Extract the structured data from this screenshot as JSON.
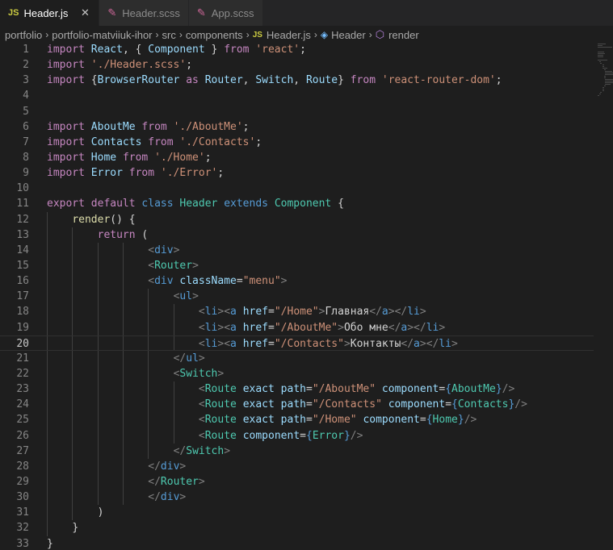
{
  "tabs": [
    {
      "label": "Header.js",
      "type": "js",
      "active": true,
      "close": "✕"
    },
    {
      "label": "Header.scss",
      "type": "scss",
      "active": false
    },
    {
      "label": "App.scss",
      "type": "scss",
      "active": false
    }
  ],
  "breadcrumb": [
    "portfolio",
    "portfolio-matviiuk-ihor",
    "src",
    "components",
    "Header.js",
    "Header",
    "render"
  ],
  "editor": {
    "current_line": 20,
    "lines": [
      {
        "n": "1",
        "indent": 0,
        "tokens": [
          [
            "kw",
            "import"
          ],
          [
            "pun",
            " "
          ],
          [
            "var",
            "React"
          ],
          [
            "pun",
            ", { "
          ],
          [
            "var",
            "Component"
          ],
          [
            "pun",
            " } "
          ],
          [
            "kw",
            "from"
          ],
          [
            "pun",
            " "
          ],
          [
            "str",
            "'react'"
          ],
          [
            "pun",
            ";"
          ]
        ]
      },
      {
        "n": "2",
        "indent": 0,
        "tokens": [
          [
            "kw",
            "import"
          ],
          [
            "pun",
            " "
          ],
          [
            "str",
            "'./Header.scss'"
          ],
          [
            "pun",
            ";"
          ]
        ]
      },
      {
        "n": "3",
        "indent": 0,
        "tokens": [
          [
            "kw",
            "import"
          ],
          [
            "pun",
            " {"
          ],
          [
            "var",
            "BrowserRouter"
          ],
          [
            "pun",
            " "
          ],
          [
            "kw",
            "as"
          ],
          [
            "pun",
            " "
          ],
          [
            "var",
            "Router"
          ],
          [
            "pun",
            ", "
          ],
          [
            "var",
            "Switch"
          ],
          [
            "pun",
            ", "
          ],
          [
            "var",
            "Route"
          ],
          [
            "pun",
            "} "
          ],
          [
            "kw",
            "from"
          ],
          [
            "pun",
            " "
          ],
          [
            "str",
            "'react-router-dom'"
          ],
          [
            "pun",
            ";"
          ]
        ]
      },
      {
        "n": "4",
        "indent": 0,
        "tokens": []
      },
      {
        "n": "5",
        "indent": 0,
        "tokens": []
      },
      {
        "n": "6",
        "indent": 0,
        "tokens": [
          [
            "kw",
            "import"
          ],
          [
            "pun",
            " "
          ],
          [
            "var",
            "AboutMe"
          ],
          [
            "pun",
            " "
          ],
          [
            "kw",
            "from"
          ],
          [
            "pun",
            " "
          ],
          [
            "str",
            "'./AboutMe'"
          ],
          [
            "pun",
            ";"
          ]
        ]
      },
      {
        "n": "7",
        "indent": 0,
        "tokens": [
          [
            "kw",
            "import"
          ],
          [
            "pun",
            " "
          ],
          [
            "var",
            "Contacts"
          ],
          [
            "pun",
            " "
          ],
          [
            "kw",
            "from"
          ],
          [
            "pun",
            " "
          ],
          [
            "str",
            "'./Contacts'"
          ],
          [
            "pun",
            ";"
          ]
        ]
      },
      {
        "n": "8",
        "indent": 0,
        "tokens": [
          [
            "kw",
            "import"
          ],
          [
            "pun",
            " "
          ],
          [
            "var",
            "Home"
          ],
          [
            "pun",
            " "
          ],
          [
            "kw",
            "from"
          ],
          [
            "pun",
            " "
          ],
          [
            "str",
            "'./Home'"
          ],
          [
            "pun",
            ";"
          ]
        ]
      },
      {
        "n": "9",
        "indent": 0,
        "tokens": [
          [
            "kw",
            "import"
          ],
          [
            "pun",
            " "
          ],
          [
            "var",
            "Error"
          ],
          [
            "pun",
            " "
          ],
          [
            "kw",
            "from"
          ],
          [
            "pun",
            " "
          ],
          [
            "str",
            "'./Error'"
          ],
          [
            "pun",
            ";"
          ]
        ]
      },
      {
        "n": "10",
        "indent": 0,
        "tokens": []
      },
      {
        "n": "11",
        "indent": 0,
        "tokens": [
          [
            "kw",
            "export"
          ],
          [
            "pun",
            " "
          ],
          [
            "kw",
            "default"
          ],
          [
            "pun",
            " "
          ],
          [
            "kw2",
            "class"
          ],
          [
            "pun",
            " "
          ],
          [
            "cls",
            "Header"
          ],
          [
            "pun",
            " "
          ],
          [
            "kw2",
            "extends"
          ],
          [
            "pun",
            " "
          ],
          [
            "cls",
            "Component"
          ],
          [
            "pun",
            " {"
          ]
        ]
      },
      {
        "n": "12",
        "indent": 1,
        "tokens": [
          [
            "fn",
            "render"
          ],
          [
            "pun",
            "() {"
          ]
        ]
      },
      {
        "n": "13",
        "indent": 2,
        "tokens": [
          [
            "kw",
            "return"
          ],
          [
            "pun",
            " ("
          ]
        ]
      },
      {
        "n": "14",
        "indent": 4,
        "tokens": [
          [
            "tag",
            "<"
          ],
          [
            "kw2",
            "div"
          ],
          [
            "tag",
            ">"
          ]
        ]
      },
      {
        "n": "15",
        "indent": 4,
        "tokens": [
          [
            "tag",
            "<"
          ],
          [
            "cls",
            "Router"
          ],
          [
            "tag",
            ">"
          ]
        ]
      },
      {
        "n": "16",
        "indent": 4,
        "tokens": [
          [
            "tag",
            "<"
          ],
          [
            "kw2",
            "div"
          ],
          [
            "pun",
            " "
          ],
          [
            "var",
            "className"
          ],
          [
            "pun",
            "="
          ],
          [
            "str",
            "\"menu\""
          ],
          [
            "tag",
            ">"
          ]
        ]
      },
      {
        "n": "17",
        "indent": 5,
        "tokens": [
          [
            "tag",
            "<"
          ],
          [
            "kw2",
            "ul"
          ],
          [
            "tag",
            ">"
          ]
        ]
      },
      {
        "n": "18",
        "indent": 6,
        "tokens": [
          [
            "tag",
            "<"
          ],
          [
            "kw2",
            "li"
          ],
          [
            "tag",
            "><"
          ],
          [
            "kw2",
            "a"
          ],
          [
            "pun",
            " "
          ],
          [
            "var",
            "href"
          ],
          [
            "pun",
            "="
          ],
          [
            "str",
            "\"/Home\""
          ],
          [
            "tag",
            ">"
          ],
          [
            "txt",
            "Главная"
          ],
          [
            "tag",
            "</"
          ],
          [
            "kw2",
            "a"
          ],
          [
            "tag",
            "></"
          ],
          [
            "kw2",
            "li"
          ],
          [
            "tag",
            ">"
          ]
        ]
      },
      {
        "n": "19",
        "indent": 6,
        "tokens": [
          [
            "tag",
            "<"
          ],
          [
            "kw2",
            "li"
          ],
          [
            "tag",
            "><"
          ],
          [
            "kw2",
            "a"
          ],
          [
            "pun",
            " "
          ],
          [
            "var",
            "href"
          ],
          [
            "pun",
            "="
          ],
          [
            "str",
            "\"/AboutMe\""
          ],
          [
            "tag",
            ">"
          ],
          [
            "txt",
            "Обо мне"
          ],
          [
            "tag",
            "</"
          ],
          [
            "kw2",
            "a"
          ],
          [
            "tag",
            "></"
          ],
          [
            "kw2",
            "li"
          ],
          [
            "tag",
            ">"
          ]
        ]
      },
      {
        "n": "20",
        "indent": 6,
        "tokens": [
          [
            "tag",
            "<"
          ],
          [
            "kw2",
            "li"
          ],
          [
            "tag",
            "><"
          ],
          [
            "kw2",
            "a"
          ],
          [
            "pun",
            " "
          ],
          [
            "var",
            "href"
          ],
          [
            "pun",
            "="
          ],
          [
            "str",
            "\"/Contacts\""
          ],
          [
            "tag",
            ">"
          ],
          [
            "txt",
            "Контакты"
          ],
          [
            "tag",
            "</"
          ],
          [
            "kw2",
            "a"
          ],
          [
            "tag",
            "><"
          ],
          [
            "tag",
            "/"
          ],
          [
            "kw2",
            "li"
          ],
          [
            "tag",
            ">"
          ]
        ]
      },
      {
        "n": "21",
        "indent": 5,
        "tokens": [
          [
            "tag",
            "</"
          ],
          [
            "kw2",
            "ul"
          ],
          [
            "tag",
            ">"
          ]
        ]
      },
      {
        "n": "22",
        "indent": 5,
        "tokens": [
          [
            "tag",
            "<"
          ],
          [
            "cls",
            "Switch"
          ],
          [
            "tag",
            ">"
          ]
        ]
      },
      {
        "n": "23",
        "indent": 6,
        "tokens": [
          [
            "tag",
            "<"
          ],
          [
            "cls",
            "Route"
          ],
          [
            "pun",
            " "
          ],
          [
            "var",
            "exact"
          ],
          [
            "pun",
            " "
          ],
          [
            "var",
            "path"
          ],
          [
            "pun",
            "="
          ],
          [
            "str",
            "\"/AboutMe\""
          ],
          [
            "pun",
            " "
          ],
          [
            "var",
            "component"
          ],
          [
            "pun",
            "="
          ],
          [
            "kw2",
            "{"
          ],
          [
            "cls",
            "AboutMe"
          ],
          [
            "kw2",
            "}"
          ],
          [
            "tag",
            "/>"
          ]
        ]
      },
      {
        "n": "24",
        "indent": 6,
        "tokens": [
          [
            "tag",
            "<"
          ],
          [
            "cls",
            "Route"
          ],
          [
            "pun",
            " "
          ],
          [
            "var",
            "exact"
          ],
          [
            "pun",
            " "
          ],
          [
            "var",
            "path"
          ],
          [
            "pun",
            "="
          ],
          [
            "str",
            "\"/Contacts\""
          ],
          [
            "pun",
            " "
          ],
          [
            "var",
            "component"
          ],
          [
            "pun",
            "="
          ],
          [
            "kw2",
            "{"
          ],
          [
            "cls",
            "Contacts"
          ],
          [
            "kw2",
            "}"
          ],
          [
            "tag",
            "/>"
          ]
        ]
      },
      {
        "n": "25",
        "indent": 6,
        "tokens": [
          [
            "tag",
            "<"
          ],
          [
            "cls",
            "Route"
          ],
          [
            "pun",
            " "
          ],
          [
            "var",
            "exact"
          ],
          [
            "pun",
            " "
          ],
          [
            "var",
            "path"
          ],
          [
            "pun",
            "="
          ],
          [
            "str",
            "\"/Home\""
          ],
          [
            "pun",
            " "
          ],
          [
            "var",
            "component"
          ],
          [
            "pun",
            "="
          ],
          [
            "kw2",
            "{"
          ],
          [
            "cls",
            "Home"
          ],
          [
            "kw2",
            "}"
          ],
          [
            "tag",
            "/>"
          ]
        ]
      },
      {
        "n": "26",
        "indent": 6,
        "tokens": [
          [
            "tag",
            "<"
          ],
          [
            "cls",
            "Route"
          ],
          [
            "pun",
            " "
          ],
          [
            "var",
            "component"
          ],
          [
            "pun",
            "="
          ],
          [
            "kw2",
            "{"
          ],
          [
            "cls",
            "Error"
          ],
          [
            "kw2",
            "}"
          ],
          [
            "tag",
            "/>"
          ]
        ]
      },
      {
        "n": "27",
        "indent": 5,
        "tokens": [
          [
            "tag",
            "</"
          ],
          [
            "cls",
            "Switch"
          ],
          [
            "tag",
            ">"
          ]
        ]
      },
      {
        "n": "28",
        "indent": 4,
        "tokens": [
          [
            "tag",
            "</"
          ],
          [
            "kw2",
            "div"
          ],
          [
            "tag",
            ">"
          ]
        ]
      },
      {
        "n": "29",
        "indent": 4,
        "tokens": [
          [
            "tag",
            "</"
          ],
          [
            "cls",
            "Router"
          ],
          [
            "tag",
            ">"
          ]
        ]
      },
      {
        "n": "30",
        "indent": 4,
        "tokens": [
          [
            "tag",
            "</"
          ],
          [
            "kw2",
            "div"
          ],
          [
            "tag",
            ">"
          ]
        ]
      },
      {
        "n": "31",
        "indent": 2,
        "tokens": [
          [
            "pun",
            ")"
          ]
        ]
      },
      {
        "n": "32",
        "indent": 1,
        "tokens": [
          [
            "pun",
            "}"
          ]
        ]
      },
      {
        "n": "33",
        "indent": 0,
        "tokens": [
          [
            "pun",
            "}"
          ]
        ]
      }
    ]
  }
}
